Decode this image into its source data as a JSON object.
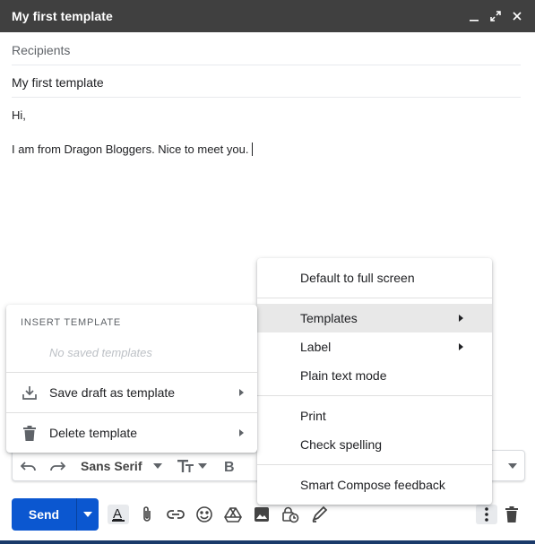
{
  "window": {
    "title": "My first template",
    "controls": [
      "minimize-icon",
      "expand-icon",
      "close-icon"
    ]
  },
  "compose": {
    "recipients_placeholder": "Recipients",
    "subject": "My first template",
    "body_lines": [
      "Hi,",
      "",
      "I am from Dragon Bloggers. Nice to meet you."
    ]
  },
  "formatting": {
    "font": "Sans Serif",
    "icons": [
      "undo-icon",
      "redo-icon",
      "font-select",
      "text-size-icon",
      "bold-icon",
      "more-formatting-icon"
    ]
  },
  "bottom_bar": {
    "send_label": "Send",
    "icons": [
      "formatting-options-icon",
      "attach-icon",
      "link-icon",
      "emoji-icon",
      "drive-icon",
      "photo-icon",
      "confidential-icon",
      "signature-icon",
      "more-options-icon",
      "discard-icon"
    ]
  },
  "more_menu": {
    "items": [
      {
        "label": "Default to full screen",
        "submenu": false
      },
      {
        "label": "Templates",
        "submenu": true,
        "highlighted": true
      },
      {
        "label": "Label",
        "submenu": true
      },
      {
        "label": "Plain text mode",
        "submenu": false
      },
      {
        "label": "Print",
        "submenu": false
      },
      {
        "label": "Check spelling",
        "submenu": false
      },
      {
        "label": "Smart Compose feedback",
        "submenu": false
      }
    ]
  },
  "templates_menu": {
    "header": "INSERT TEMPLATE",
    "empty_text": "No saved templates",
    "items": [
      {
        "label": "Save draft as template",
        "icon": "download-icon"
      },
      {
        "label": "Delete template",
        "icon": "trash-icon"
      }
    ]
  },
  "colors": {
    "titlebar": "#404040",
    "send_button": "#0b57d0",
    "menu_highlight": "#e8e8e8"
  }
}
